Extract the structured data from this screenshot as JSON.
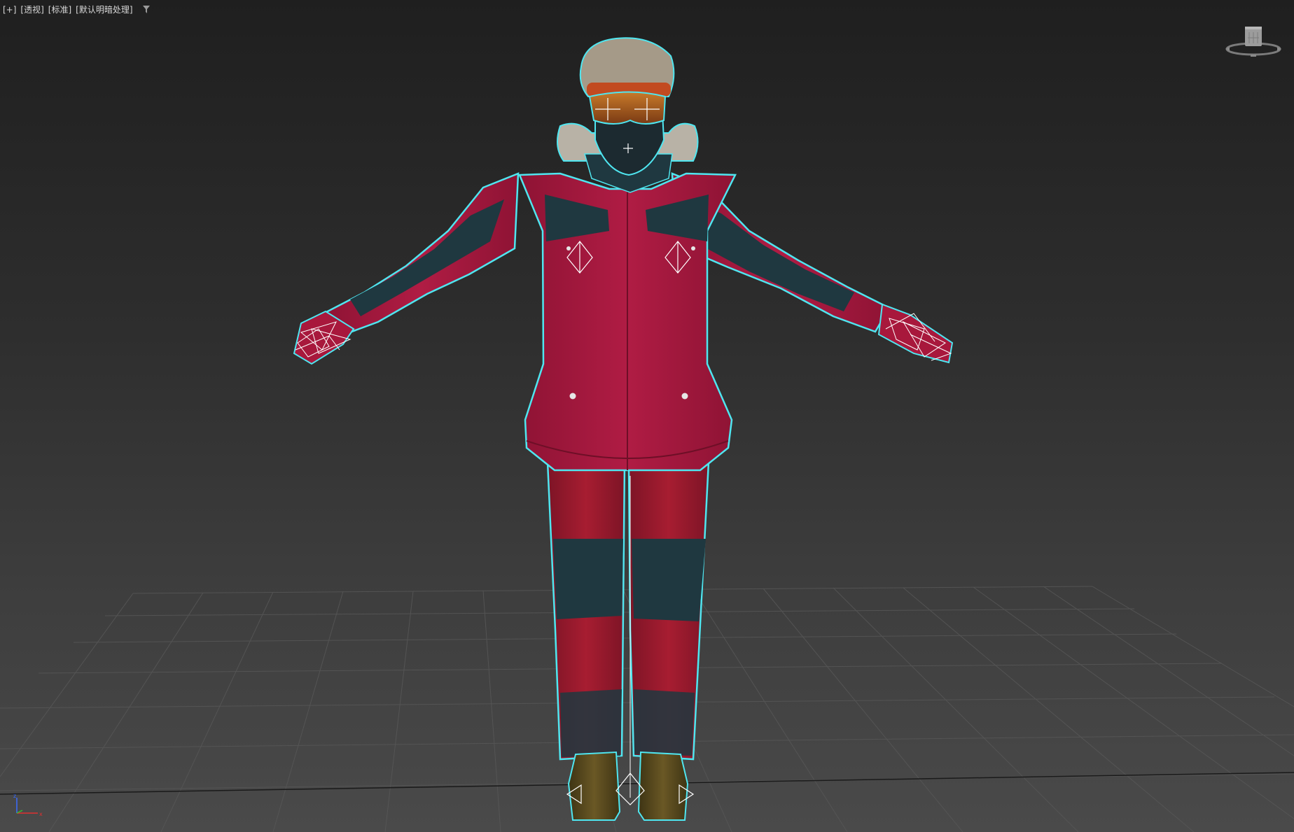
{
  "viewport": {
    "labels": {
      "plus": "[+]",
      "view": "[透视]",
      "shading": "[标准]",
      "lighting": "[默认明暗处理]"
    },
    "icons": {
      "filter": "filter-funnel-icon",
      "viewcube": "viewcube-icon",
      "axis": "world-axis-tripod-icon"
    },
    "colors": {
      "selection_outline": "#4fe6f0",
      "jacket_red": "#a8183c",
      "jacket_dark": "#1f3840",
      "pants_red": "#a01a2e",
      "boots": "#5a4a20",
      "grid": "#585858",
      "background_top": "#1f1f1f",
      "background_bottom": "#4a4a4a"
    }
  }
}
